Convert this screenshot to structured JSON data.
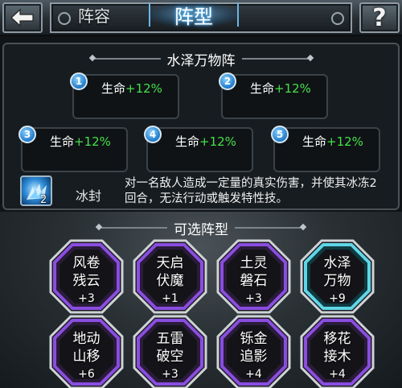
{
  "header": {
    "tabs": [
      {
        "label": "阵容",
        "active": false
      },
      {
        "label": "阵型",
        "active": true
      }
    ],
    "help_label": "?"
  },
  "current_formation": {
    "title": "水泽万物阵",
    "slots": [
      {
        "number": "1",
        "stat": "生命",
        "value": "+12%"
      },
      {
        "number": "2",
        "stat": "生命",
        "value": "+12%"
      },
      {
        "number": "3",
        "stat": "生命",
        "value": "+12%"
      },
      {
        "number": "4",
        "stat": "生命",
        "value": "+12%"
      },
      {
        "number": "5",
        "stat": "生命",
        "value": "+12%"
      }
    ],
    "skill": {
      "icon": "ice-crystal-icon",
      "level": "2",
      "name": "冰封",
      "description": "对一名敌人造成一定量的真实伤害，并使其冰冻2回合，无法行动或触发特性技。"
    }
  },
  "available": {
    "title": "可选阵型",
    "formations": [
      {
        "line1": "风卷",
        "line2": "残云",
        "bonus": "+3",
        "selected": false
      },
      {
        "line1": "天启",
        "line2": "伏魔",
        "bonus": "+1",
        "selected": false
      },
      {
        "line1": "土灵",
        "line2": "磐石",
        "bonus": "+3",
        "selected": false
      },
      {
        "line1": "水泽",
        "line2": "万物",
        "bonus": "+9",
        "selected": true
      },
      {
        "line1": "地动",
        "line2": "山移",
        "bonus": "+6",
        "selected": false
      },
      {
        "line1": "五雷",
        "line2": "破空",
        "bonus": "+3",
        "selected": false
      },
      {
        "line1": "铄金",
        "line2": "追影",
        "bonus": "+4",
        "selected": false
      },
      {
        "line1": "移花",
        "line2": "接木",
        "bonus": "+4",
        "selected": false
      }
    ]
  },
  "colors": {
    "bonus_green": "#46e04a",
    "active_tab_glow": "#45b4ff",
    "hex_border_purple": "#8a4de0",
    "hex_border_selected": "#5fd6e6"
  }
}
